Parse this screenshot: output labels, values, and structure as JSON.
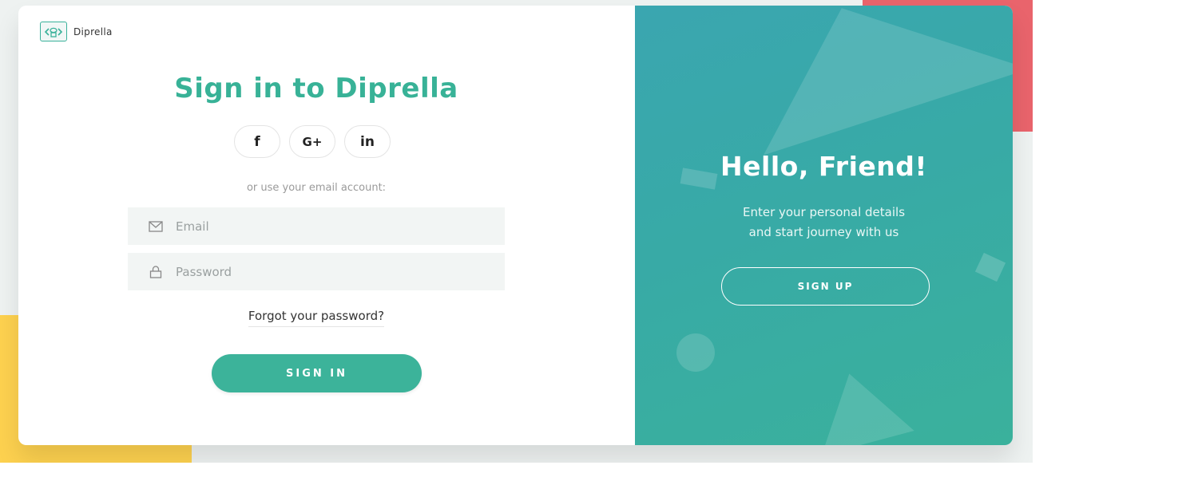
{
  "brand": {
    "name": "Diprella",
    "logo_icon": "code-cloud-icon"
  },
  "signin": {
    "title": "Sign in to Diprella",
    "social": [
      {
        "label": "f",
        "icon": "facebook-icon"
      },
      {
        "label": "G+",
        "icon": "google-plus-icon"
      },
      {
        "label": "in",
        "icon": "linkedin-icon"
      }
    ],
    "hint": "or use your email account:",
    "email": {
      "placeholder": "Email",
      "value": "",
      "icon": "mail-icon"
    },
    "password": {
      "placeholder": "Password",
      "value": "",
      "icon": "lock-icon"
    },
    "forgot_label": "Forgot your password?",
    "button_label": "SIGN IN"
  },
  "welcome": {
    "title": "Hello, Friend!",
    "line1": "Enter your personal details",
    "line2": "and start journey with us",
    "button_label": "SIGN UP"
  },
  "colors": {
    "accent": "#38b297",
    "panel_start": "#3aa6b0",
    "panel_end": "#3ab19c",
    "deco_red": "#e9646c",
    "deco_yellow": "#fdd14f"
  }
}
